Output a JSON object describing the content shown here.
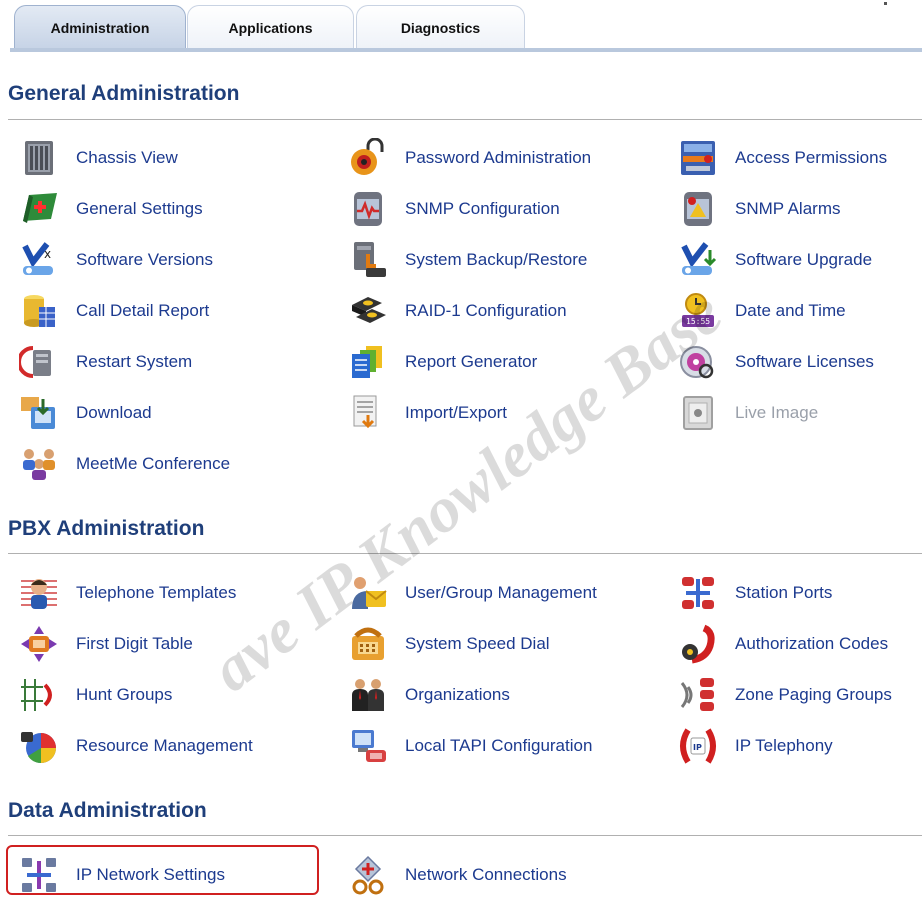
{
  "tabs": {
    "administration": "Administration",
    "applications": "Applications",
    "diagnostics": "Diagnostics"
  },
  "sections": {
    "general": {
      "title": "General Administration",
      "items": [
        {
          "label": "Chassis View",
          "icon": "chassis-icon"
        },
        {
          "label": "Password Administration",
          "icon": "password-icon"
        },
        {
          "label": "Access Permissions",
          "icon": "access-permissions-icon"
        },
        {
          "label": "General Settings",
          "icon": "general-settings-icon"
        },
        {
          "label": "SNMP Configuration",
          "icon": "snmp-config-icon"
        },
        {
          "label": "SNMP Alarms",
          "icon": "snmp-alarms-icon"
        },
        {
          "label": "Software Versions",
          "icon": "software-versions-icon"
        },
        {
          "label": "System Backup/Restore",
          "icon": "backup-restore-icon"
        },
        {
          "label": "Software Upgrade",
          "icon": "software-upgrade-icon"
        },
        {
          "label": "Call Detail Report",
          "icon": "call-detail-icon"
        },
        {
          "label": "RAID-1 Configuration",
          "icon": "raid-icon"
        },
        {
          "label": "Date and Time",
          "icon": "clock-icon"
        },
        {
          "label": "Restart System",
          "icon": "restart-icon"
        },
        {
          "label": "Report Generator",
          "icon": "report-generator-icon"
        },
        {
          "label": "Software Licenses",
          "icon": "licenses-icon"
        },
        {
          "label": "Download",
          "icon": "download-icon"
        },
        {
          "label": "Import/Export",
          "icon": "import-export-icon"
        },
        {
          "label": "Live Image",
          "icon": "live-image-icon"
        },
        {
          "label": "MeetMe Conference",
          "icon": "conference-icon"
        }
      ]
    },
    "pbx": {
      "title": "PBX Administration",
      "items": [
        {
          "label": "Telephone Templates",
          "icon": "telephone-templates-icon"
        },
        {
          "label": "User/Group Management",
          "icon": "user-group-icon"
        },
        {
          "label": "Station Ports",
          "icon": "station-ports-icon"
        },
        {
          "label": "First Digit Table",
          "icon": "first-digit-icon"
        },
        {
          "label": "System Speed Dial",
          "icon": "speed-dial-icon"
        },
        {
          "label": "Authorization Codes",
          "icon": "authorization-icon"
        },
        {
          "label": "Hunt Groups",
          "icon": "hunt-groups-icon"
        },
        {
          "label": "Organizations",
          "icon": "organizations-icon"
        },
        {
          "label": "Zone Paging Groups",
          "icon": "zone-paging-icon"
        },
        {
          "label": "Resource Management",
          "icon": "resource-icon"
        },
        {
          "label": "Local TAPI Configuration",
          "icon": "tapi-icon"
        },
        {
          "label": "IP Telephony",
          "icon": "ip-telephony-icon"
        }
      ]
    },
    "data": {
      "title": "Data Administration",
      "items": [
        {
          "label": "IP Network Settings",
          "icon": "ip-network-icon"
        },
        {
          "label": "Network Connections",
          "icon": "network-connections-icon"
        }
      ]
    }
  },
  "watermark": "ave IP Knowledge Base",
  "colors": {
    "section_title": "#1f3f7a",
    "link": "#1c3a8f",
    "disabled": "#9aa0aa",
    "highlight": "#d02020",
    "tab_line": "#b9c8dd"
  }
}
